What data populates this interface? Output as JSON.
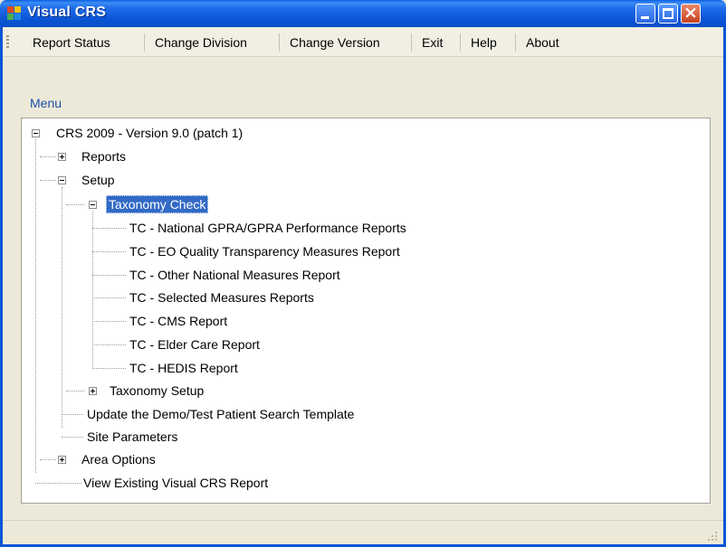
{
  "window": {
    "title": "Visual CRS",
    "icon": "visual-crs-app-icon",
    "controls": [
      "minimize",
      "maximize",
      "close"
    ]
  },
  "menubar": {
    "items": [
      "Report Status",
      "Change Division",
      "Change Version",
      "Exit",
      "Help",
      "About"
    ]
  },
  "menu_group": {
    "label": "Menu"
  },
  "tree": {
    "root": "CRS 2009 - Version 9.0 (patch 1)",
    "reports": "Reports",
    "setup": "Setup",
    "taxonomy_check": "Taxonomy Check",
    "tc_items": [
      "TC - National GPRA/GPRA Performance Reports",
      "TC - EO Quality Transparency Measures Report",
      "TC - Other National Measures Report",
      "TC - Selected Measures Reports",
      "TC - CMS Report",
      "TC - Elder Care Report",
      "TC - HEDIS Report"
    ],
    "taxonomy_setup": "Taxonomy Setup",
    "update_demo": "Update the Demo/Test Patient Search Template",
    "site_parameters": "Site Parameters",
    "area_options": "Area Options",
    "view_existing": "View Existing Visual CRS Report",
    "selected_node": "Taxonomy Check",
    "colors": {
      "selection": "#316ac5",
      "group_label": "#1c4ea7",
      "titlebar": "#0b55d6"
    }
  }
}
